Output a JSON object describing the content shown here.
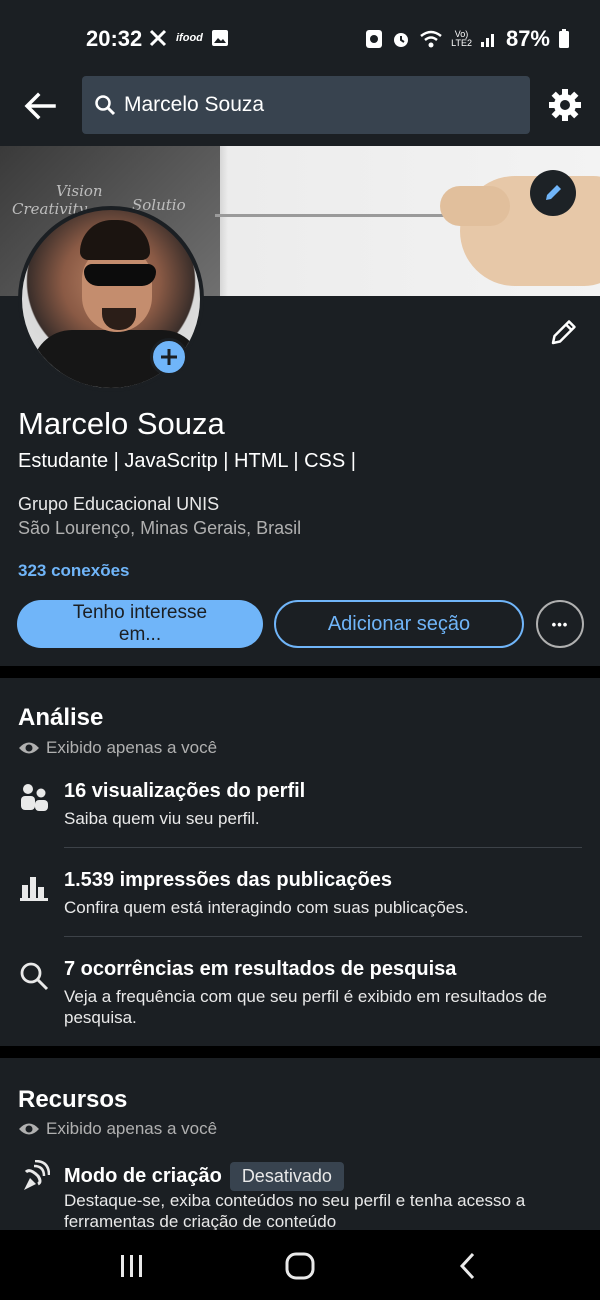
{
  "status_bar": {
    "time": "20:32",
    "battery": "87%",
    "left_icons": [
      "tools-icon",
      "ifood-icon",
      "gallery-icon"
    ],
    "right_icons": [
      "nfc-icon",
      "alarm-icon",
      "wifi-icon",
      "volte-icon",
      "signal-icon",
      "battery-icon"
    ]
  },
  "top_nav": {
    "search_query": "Marcelo Souza",
    "icons": [
      "back-arrow-icon",
      "search-icon",
      "gear-icon"
    ]
  },
  "banner": {
    "chalk_words": [
      "Vision",
      "Creativity",
      "Solutio"
    ]
  },
  "profile": {
    "name": "Marcelo Souza",
    "headline": "Estudante | JavaScritp | HTML | CSS |",
    "company": "Grupo Educacional UNIS",
    "location": "São Lourenço, Minas Gerais, Brasil",
    "connections": "323 conexões",
    "open_to_label_line1": "Tenho interesse",
    "open_to_label_line2": "em...",
    "add_section_label": "Adicionar seção",
    "more_label": "•••"
  },
  "analytics": {
    "title": "Análise",
    "private_label": "Exibido apenas a você",
    "items": [
      {
        "title": "16 visualizações do perfil",
        "subtitle": "Saiba quem viu seu perfil.",
        "icon": "people-icon"
      },
      {
        "title": "1.539 impressões das publicações",
        "subtitle": "Confira quem está interagindo com suas publicações.",
        "icon": "bar-chart-icon"
      },
      {
        "title": "7 ocorrências em resultados de pesquisa",
        "subtitle": "Veja a frequência com que seu perfil é exibido em resultados de pesquisa.",
        "icon": "search-icon"
      }
    ]
  },
  "resources": {
    "title": "Recursos",
    "private_label": "Exibido apenas a você",
    "items": [
      {
        "title": "Modo de criação",
        "badge": "Desativado",
        "subtitle": "Destaque-se, exiba conteúdos no seu perfil e tenha acesso a ferramentas de criação de conteúdo",
        "icon": "satellite-icon"
      }
    ]
  },
  "colors": {
    "background": "#1b1f23",
    "accent": "#70b5f9",
    "search_bg": "#38434f"
  }
}
